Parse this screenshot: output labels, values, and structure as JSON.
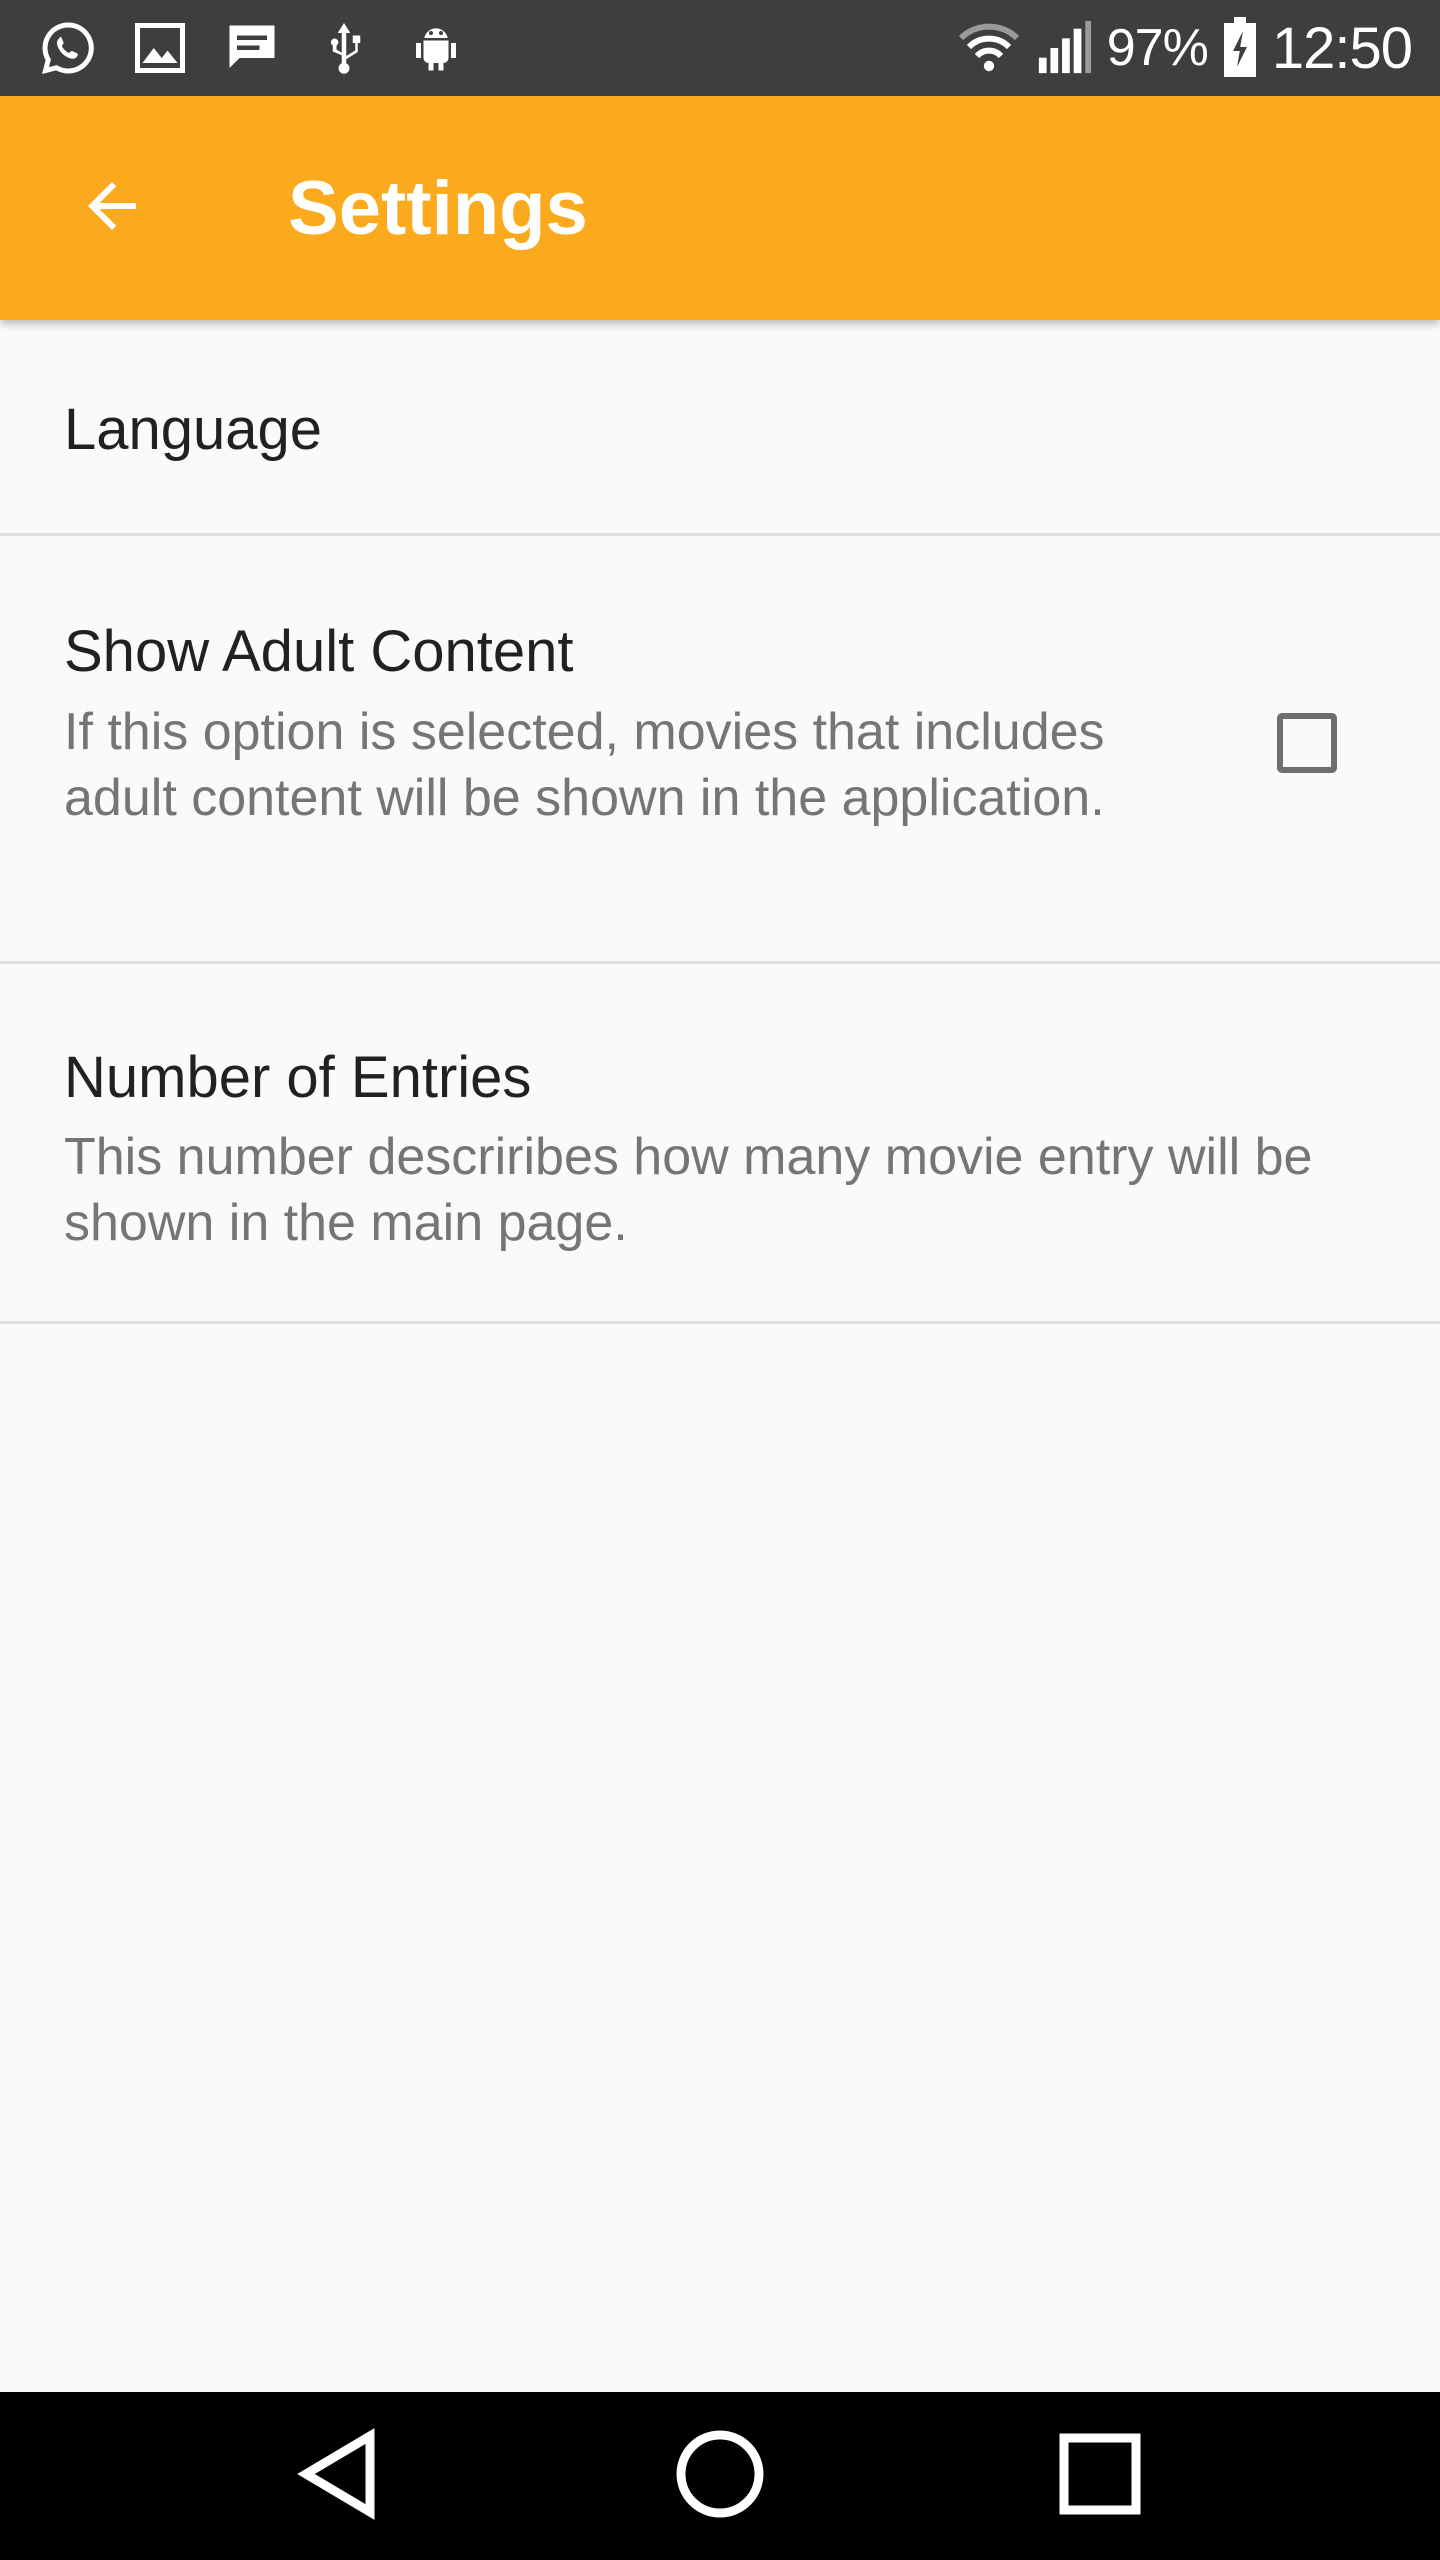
{
  "status_bar": {
    "battery": "97%",
    "time": "12:50",
    "left_icons": [
      "whatsapp-icon",
      "image-icon",
      "message-icon",
      "usb-icon",
      "android-debug-icon"
    ],
    "right_icons": [
      "wifi-icon",
      "signal-icon",
      "battery-charging-icon"
    ]
  },
  "app_bar": {
    "title": "Settings",
    "background": "#fbaa1e",
    "back_icon": "arrow-back-icon"
  },
  "preferences": [
    {
      "title": "Language"
    },
    {
      "title": "Show Adult Content",
      "summary": "If this option is selected, movies that includes adult content will be shown in the application.",
      "checkbox_checked": false
    },
    {
      "title": "Number of Entries",
      "summary": "This number descriribes how many movie entry will be shown in the main page."
    }
  ],
  "nav_bar": {
    "buttons": [
      "back-triangle-icon",
      "home-circle-icon",
      "recents-square-icon"
    ]
  }
}
